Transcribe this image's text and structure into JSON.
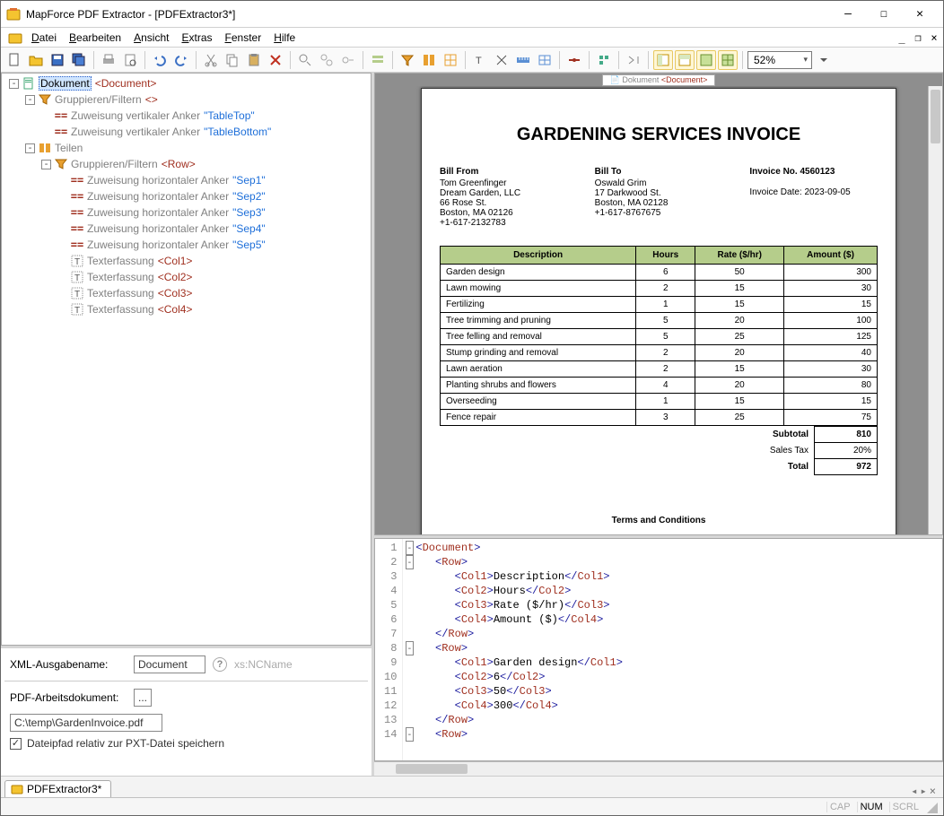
{
  "app_title": "MapForce PDF Extractor - [PDFExtractor3*]",
  "menu": {
    "datei": "Datei",
    "bearbeiten": "Bearbeiten",
    "ansicht": "Ansicht",
    "extras": "Extras",
    "fenster": "Fenster",
    "hilfe": "Hilfe"
  },
  "zoom": "52%",
  "tree": [
    {
      "depth": 0,
      "tog": "-",
      "icon": "doc",
      "label": "Dokument",
      "tag": "<Document>",
      "sel": true
    },
    {
      "depth": 1,
      "tog": "-",
      "icon": "grp",
      "label": "Gruppieren/Filtern",
      "tag": "<>"
    },
    {
      "depth": 2,
      "icon": "anch",
      "label": "Zuweisung vertikaler Anker",
      "str": "\"TableTop\""
    },
    {
      "depth": 2,
      "icon": "anch",
      "label": "Zuweisung vertikaler Anker",
      "str": "\"TableBottom\""
    },
    {
      "depth": 1,
      "tog": "-",
      "icon": "split",
      "label": "Teilen"
    },
    {
      "depth": 2,
      "tog": "-",
      "icon": "grp",
      "label": "Gruppieren/Filtern",
      "tag": "<Row>"
    },
    {
      "depth": 3,
      "icon": "anch",
      "label": "Zuweisung horizontaler Anker",
      "str": "\"Sep1\""
    },
    {
      "depth": 3,
      "icon": "anch",
      "label": "Zuweisung horizontaler Anker",
      "str": "\"Sep2\""
    },
    {
      "depth": 3,
      "icon": "anch",
      "label": "Zuweisung horizontaler Anker",
      "str": "\"Sep3\""
    },
    {
      "depth": 3,
      "icon": "anch",
      "label": "Zuweisung horizontaler Anker",
      "str": "\"Sep4\""
    },
    {
      "depth": 3,
      "icon": "anch",
      "label": "Zuweisung horizontaler Anker",
      "str": "\"Sep5\""
    },
    {
      "depth": 3,
      "icon": "txt",
      "label": "Texterfassung",
      "tag": "<Col1>"
    },
    {
      "depth": 3,
      "icon": "txt",
      "label": "Texterfassung",
      "tag": "<Col2>"
    },
    {
      "depth": 3,
      "icon": "txt",
      "label": "Texterfassung",
      "tag": "<Col3>"
    },
    {
      "depth": 3,
      "icon": "txt",
      "label": "Texterfassung",
      "tag": "<Col4>"
    }
  ],
  "props": {
    "xml_label": "XML-Ausgabename:",
    "xml_value": "Document",
    "xml_type": "xs:NCName",
    "pdf_label": "PDF-Arbeitsdokument:",
    "pdf_path": "C:\\temp\\GardenInvoice.pdf",
    "chk_label": "Dateipfad relativ zur PXT-Datei speichern"
  },
  "preview_tag": {
    "pre": "Dokument ",
    "name": "<Document>"
  },
  "invoice": {
    "title": "GARDENING SERVICES INVOICE",
    "bill_from_h": "Bill From",
    "bill_to_h": "Bill To",
    "from": [
      "Tom Greenfinger",
      "Dream Garden, LLC",
      "66 Rose St.",
      "Boston, MA 02126",
      "+1-617-2132783"
    ],
    "to": [
      "Oswald Grim",
      "17 Darkwood St.",
      "Boston, MA 02128",
      "+1-617-8767675"
    ],
    "inv_no": "Invoice No. 4560123",
    "inv_date_l": "Invoice Date:",
    "inv_date": "2023-09-05",
    "headers": [
      "Description",
      "Hours",
      "Rate ($/hr)",
      "Amount ($)"
    ],
    "rows": [
      [
        "Garden design",
        "6",
        "50",
        "300"
      ],
      [
        "Lawn mowing",
        "2",
        "15",
        "30"
      ],
      [
        "Fertilizing",
        "1",
        "15",
        "15"
      ],
      [
        "Tree trimming and pruning",
        "5",
        "20",
        "100"
      ],
      [
        "Tree felling and removal",
        "5",
        "25",
        "125"
      ],
      [
        "Stump grinding and removal",
        "2",
        "20",
        "40"
      ],
      [
        "Lawn aeration",
        "2",
        "15",
        "30"
      ],
      [
        "Planting shrubs and flowers",
        "4",
        "20",
        "80"
      ],
      [
        "Overseeding",
        "1",
        "15",
        "15"
      ],
      [
        "Fence repair",
        "3",
        "25",
        "75"
      ]
    ],
    "subtotal_l": "Subtotal",
    "subtotal": "810",
    "tax_l": "Sales Tax",
    "tax": "20%",
    "total_l": "Total",
    "total": "972",
    "terms": "Terms and Conditions"
  },
  "xml_lines": [
    {
      "n": 1,
      "fold": "-",
      "html": "<span class='xpunc'>&lt;</span><span class='xelem'>Document</span><span class='xpunc'>&gt;</span>"
    },
    {
      "n": 2,
      "fold": "-",
      "html": "   <span class='xpunc'>&lt;</span><span class='xelem'>Row</span><span class='xpunc'>&gt;</span>"
    },
    {
      "n": 3,
      "html": "      <span class='xpunc'>&lt;</span><span class='xelem'>Col1</span><span class='xpunc'>&gt;</span><span class='xtext'>Description</span><span class='xpunc'>&lt;/</span><span class='xelem'>Col1</span><span class='xpunc'>&gt;</span>"
    },
    {
      "n": 4,
      "html": "      <span class='xpunc'>&lt;</span><span class='xelem'>Col2</span><span class='xpunc'>&gt;</span><span class='xtext'>Hours</span><span class='xpunc'>&lt;/</span><span class='xelem'>Col2</span><span class='xpunc'>&gt;</span>"
    },
    {
      "n": 5,
      "html": "      <span class='xpunc'>&lt;</span><span class='xelem'>Col3</span><span class='xpunc'>&gt;</span><span class='xtext'>Rate ($/hr)</span><span class='xpunc'>&lt;/</span><span class='xelem'>Col3</span><span class='xpunc'>&gt;</span>"
    },
    {
      "n": 6,
      "html": "      <span class='xpunc'>&lt;</span><span class='xelem'>Col4</span><span class='xpunc'>&gt;</span><span class='xtext'>Amount ($)</span><span class='xpunc'>&lt;/</span><span class='xelem'>Col4</span><span class='xpunc'>&gt;</span>"
    },
    {
      "n": 7,
      "html": "   <span class='xpunc'>&lt;/</span><span class='xelem'>Row</span><span class='xpunc'>&gt;</span>"
    },
    {
      "n": 8,
      "fold": "-",
      "html": "   <span class='xpunc'>&lt;</span><span class='xelem'>Row</span><span class='xpunc'>&gt;</span>"
    },
    {
      "n": 9,
      "html": "      <span class='xpunc'>&lt;</span><span class='xelem'>Col1</span><span class='xpunc'>&gt;</span><span class='xtext'>Garden design</span><span class='xpunc'>&lt;/</span><span class='xelem'>Col1</span><span class='xpunc'>&gt;</span>"
    },
    {
      "n": 10,
      "html": "      <span class='xpunc'>&lt;</span><span class='xelem'>Col2</span><span class='xpunc'>&gt;</span><span class='xtext'>6</span><span class='xpunc'>&lt;/</span><span class='xelem'>Col2</span><span class='xpunc'>&gt;</span>"
    },
    {
      "n": 11,
      "html": "      <span class='xpunc'>&lt;</span><span class='xelem'>Col3</span><span class='xpunc'>&gt;</span><span class='xtext'>50</span><span class='xpunc'>&lt;/</span><span class='xelem'>Col3</span><span class='xpunc'>&gt;</span>"
    },
    {
      "n": 12,
      "html": "      <span class='xpunc'>&lt;</span><span class='xelem'>Col4</span><span class='xpunc'>&gt;</span><span class='xtext'>300</span><span class='xpunc'>&lt;/</span><span class='xelem'>Col4</span><span class='xpunc'>&gt;</span>"
    },
    {
      "n": 13,
      "html": "   <span class='xpunc'>&lt;/</span><span class='xelem'>Row</span><span class='xpunc'>&gt;</span>"
    },
    {
      "n": 14,
      "fold": "-",
      "html": "   <span class='xpunc'>&lt;</span><span class='xelem'>Row</span><span class='xpunc'>&gt;</span>"
    }
  ],
  "doctab": "PDFExtractor3*",
  "status": {
    "cap": "CAP",
    "num": "NUM",
    "scrl": "SCRL"
  }
}
